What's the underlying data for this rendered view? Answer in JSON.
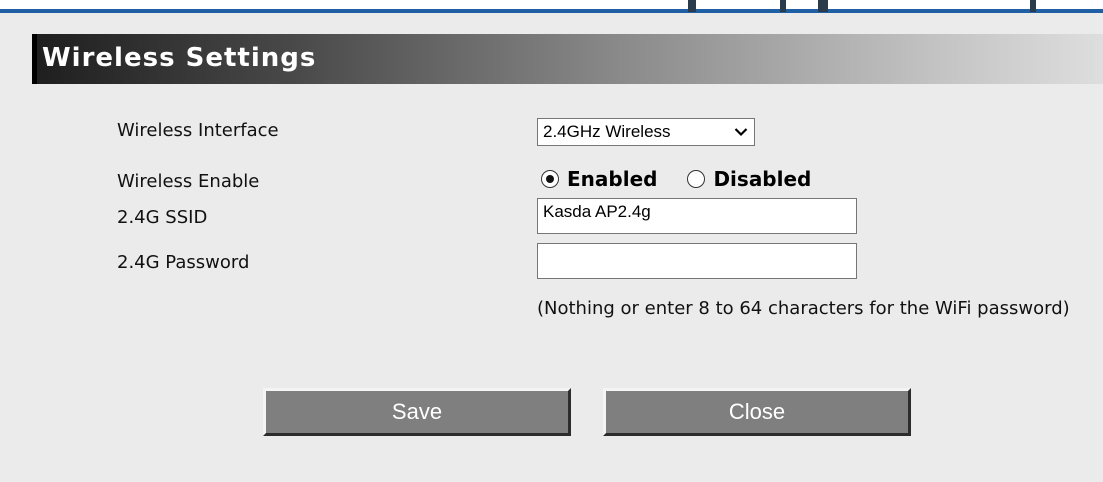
{
  "header": {
    "title": "Wireless Settings"
  },
  "form": {
    "interface": {
      "label": "Wireless Interface",
      "selected": "2.4GHz Wireless"
    },
    "enable": {
      "label": "Wireless Enable",
      "options": [
        {
          "label": "Enabled",
          "checked": true
        },
        {
          "label": "Disabled",
          "checked": false
        }
      ]
    },
    "ssid": {
      "label": "2.4G SSID",
      "value": "Kasda AP2.4g"
    },
    "password": {
      "label": "2.4G Password",
      "value": "",
      "hint": "(Nothing or enter 8 to 64 characters for the WiFi password)"
    }
  },
  "buttons": {
    "save": "Save",
    "close": "Close"
  },
  "icons": {
    "select_arrow": "chevron-down-icon"
  },
  "colors": {
    "header_dark": "#1e1e1e",
    "header_light": "#dedede",
    "button_bg": "#7f7f7f",
    "page_bg": "#ebebeb",
    "accent_blue": "#1f5fa3"
  }
}
